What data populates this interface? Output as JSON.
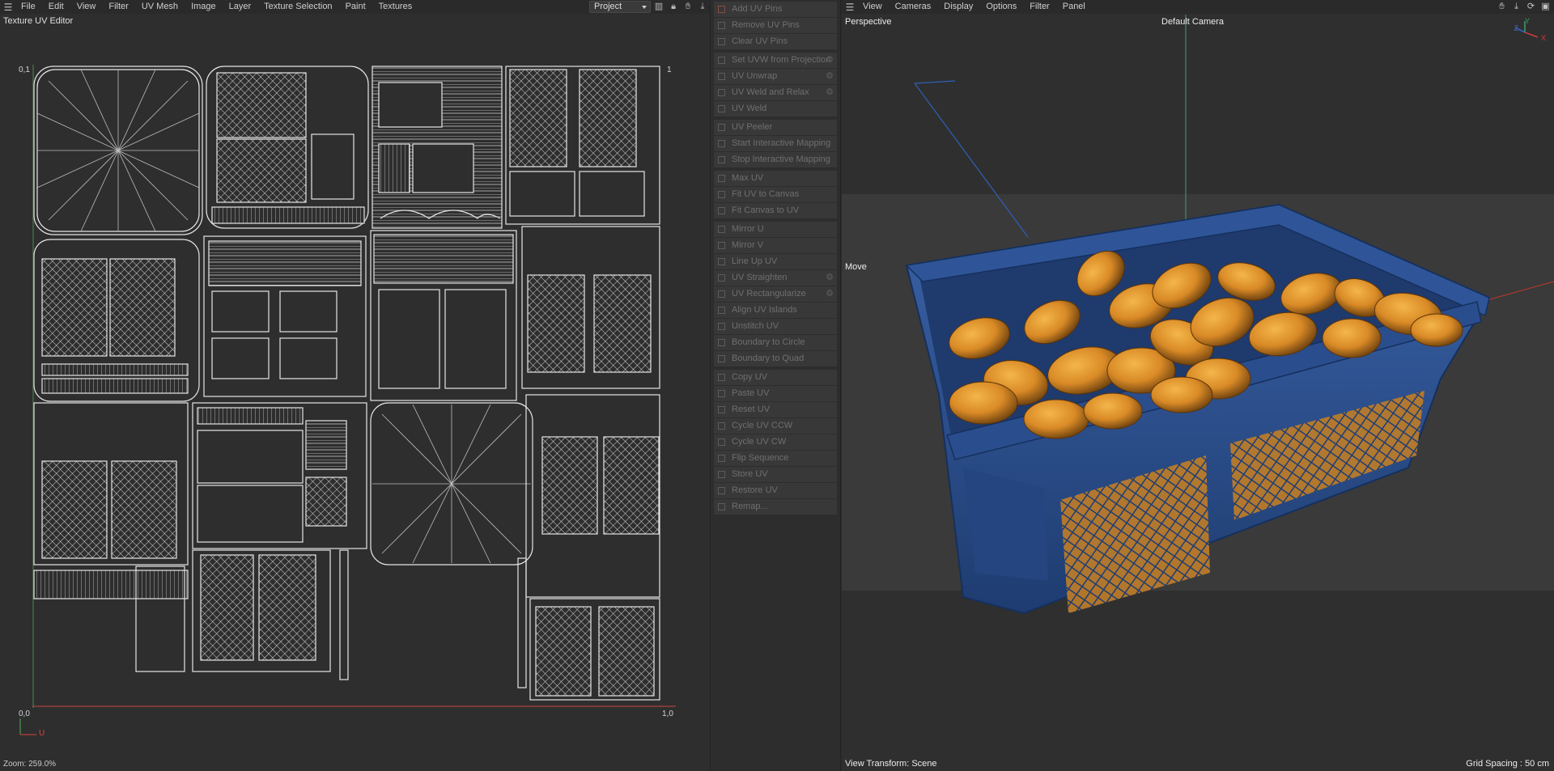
{
  "uv_editor": {
    "menu": [
      "File",
      "Edit",
      "View",
      "Filter",
      "UV Mesh",
      "Image",
      "Layer",
      "Texture Selection",
      "Paint",
      "Textures"
    ],
    "project_select": "Project",
    "title": "Texture UV Editor",
    "labels": {
      "top_left": "0,1",
      "top_right": "1",
      "origin": "0,0",
      "right": "1,0",
      "axis_u": "U"
    },
    "zoom": "Zoom: 259.0%",
    "toolbar_icons": [
      "histogram-icon",
      "lock-icon",
      "hand-pan-icon",
      "move-down-icon"
    ]
  },
  "uv_commands": {
    "groups": [
      {
        "items": [
          {
            "label": "Add UV Pins",
            "icon": "add-pin-icon",
            "gear": false
          },
          {
            "label": "Remove UV Pins",
            "icon": "remove-pin-icon",
            "gear": false
          },
          {
            "label": "Clear UV Pins",
            "icon": "clear-pin-icon",
            "gear": false
          }
        ]
      },
      {
        "items": [
          {
            "label": "Set UVW from Projection",
            "icon": "projection-icon",
            "gear": true
          },
          {
            "label": "UV Unwrap",
            "icon": "unwrap-icon",
            "gear": true
          },
          {
            "label": "UV Weld and Relax",
            "icon": "weld-relax-icon",
            "gear": true
          },
          {
            "label": "UV Weld",
            "icon": "weld-icon",
            "gear": false
          }
        ]
      },
      {
        "items": [
          {
            "label": "UV Peeler",
            "icon": "peeler-icon",
            "gear": false
          },
          {
            "label": "Start Interactive Mapping",
            "icon": "play-icon",
            "gear": false
          },
          {
            "label": "Stop Interactive Mapping",
            "icon": "stop-icon",
            "gear": false
          }
        ]
      },
      {
        "items": [
          {
            "label": "Max UV",
            "icon": "max-uv-icon",
            "gear": false
          },
          {
            "label": "Fit UV to Canvas",
            "icon": "fit-uv-icon",
            "gear": false
          },
          {
            "label": "Fit Canvas to UV",
            "icon": "fit-canvas-icon",
            "gear": false
          }
        ]
      },
      {
        "items": [
          {
            "label": "Mirror U",
            "icon": "mirror-u-icon",
            "gear": false
          },
          {
            "label": "Mirror V",
            "icon": "mirror-v-icon",
            "gear": false
          },
          {
            "label": "Line Up UV",
            "icon": "line-up-icon",
            "gear": false
          },
          {
            "label": "UV Straighten",
            "icon": "straighten-icon",
            "gear": true
          },
          {
            "label": "UV Rectangularize",
            "icon": "rectangularize-icon",
            "gear": true
          },
          {
            "label": "Align UV Islands",
            "icon": "align-icon",
            "gear": false
          },
          {
            "label": "Unstitch UV",
            "icon": "unstitch-icon",
            "gear": false
          },
          {
            "label": "Boundary to Circle",
            "icon": "circle-icon",
            "gear": false
          },
          {
            "label": "Boundary to Quad",
            "icon": "quad-icon",
            "gear": false
          }
        ]
      },
      {
        "items": [
          {
            "label": "Copy UV",
            "icon": "copy-icon",
            "gear": false
          },
          {
            "label": "Paste UV",
            "icon": "paste-icon",
            "gear": false
          },
          {
            "label": "Reset UV",
            "icon": "reset-icon",
            "gear": false
          },
          {
            "label": "Cycle UV CCW",
            "icon": "cycle-ccw-icon",
            "gear": false
          },
          {
            "label": "Cycle UV CW",
            "icon": "cycle-cw-icon",
            "gear": false
          },
          {
            "label": "Flip Sequence",
            "icon": "flip-icon",
            "gear": false
          },
          {
            "label": "Store UV",
            "icon": "store-icon",
            "gear": false
          },
          {
            "label": "Restore UV",
            "icon": "restore-icon",
            "gear": false
          },
          {
            "label": "Remap...",
            "icon": "remap-icon",
            "gear": false
          }
        ]
      }
    ]
  },
  "viewport": {
    "menu": [
      "View",
      "Cameras",
      "Display",
      "Options",
      "Filter",
      "Panel"
    ],
    "label": "Perspective",
    "camera": "Default Camera",
    "tool": "Move",
    "view_transform": "View Transform: Scene",
    "grid_spacing": "Grid Spacing : 50 cm",
    "axis": {
      "x": "X",
      "y": "Y",
      "z": "Z"
    },
    "colors": {
      "basket": "#2c4f8f",
      "fruit": "#d98a26",
      "floor": "#3d3d3d"
    },
    "toolbar_icons": [
      "hand-pan-icon",
      "move-down-icon",
      "rotate-icon",
      "maximize-icon"
    ]
  }
}
